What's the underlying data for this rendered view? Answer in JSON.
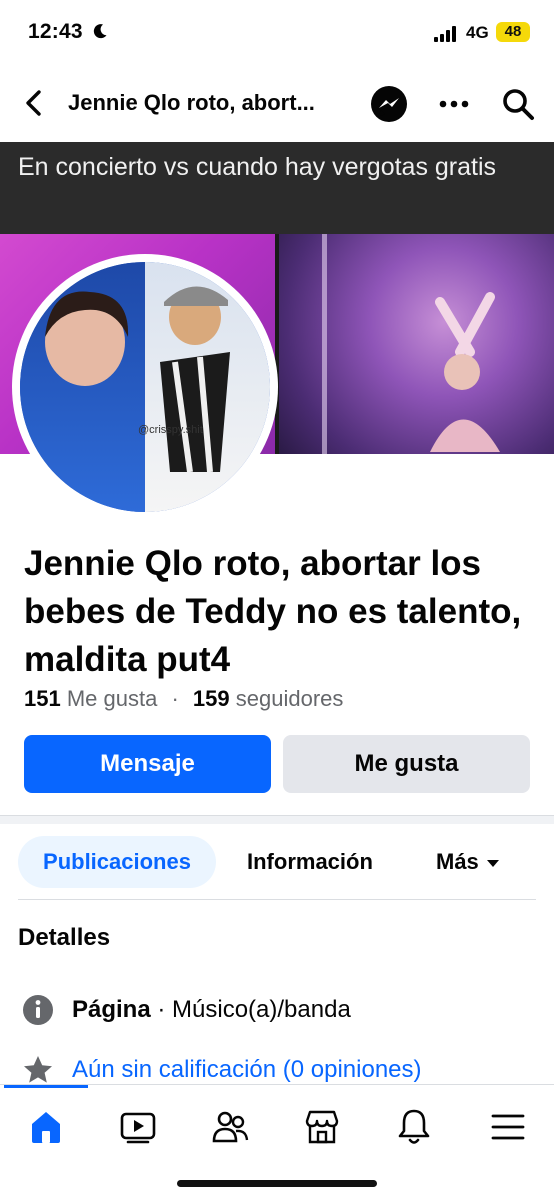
{
  "status_bar": {
    "time": "12:43",
    "network": "4G",
    "battery": "48"
  },
  "header": {
    "title": "Jennie Qlo roto, abort..."
  },
  "cover": {
    "caption": "En concierto  vs cuando hay vergotas gratis",
    "avatar_watermark": "@crisspy.shit"
  },
  "page": {
    "name": "Jennie Qlo roto, abortar los bebes de Teddy no es talento, maldita put4",
    "likes_count": "151",
    "likes_label": "Me gusta",
    "separator": "·",
    "followers_count": "159",
    "followers_label": "seguidores"
  },
  "actions": {
    "message_label": "Mensaje",
    "like_label": "Me gusta"
  },
  "tabs": {
    "posts": "Publicaciones",
    "info": "Información",
    "more": "Más"
  },
  "details": {
    "title": "Detalles",
    "category_strong": "Página",
    "category_rest": " · Músico(a)/banda",
    "rating": "Aún sin calificación (0 opiniones)"
  },
  "colors": {
    "accent": "#0866ff",
    "secondary_button": "#e4e6eb",
    "tab_active_bg": "#ebf5ff"
  }
}
